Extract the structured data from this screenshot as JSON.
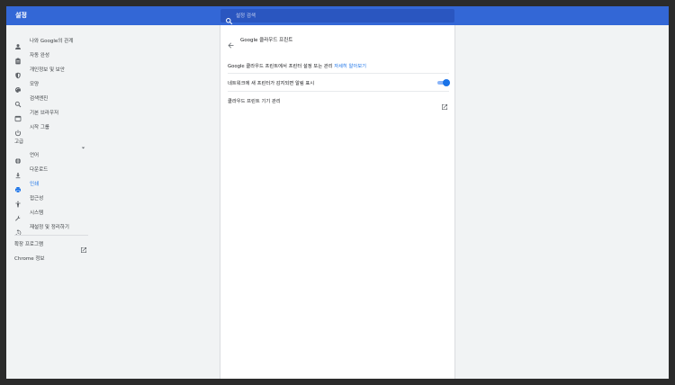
{
  "app": {
    "title": "설정"
  },
  "search": {
    "placeholder": "설정 검색"
  },
  "sidebar": {
    "items": [
      {
        "label": "나와 Google의 관계",
        "icon": "person-icon"
      },
      {
        "label": "자동 완성",
        "icon": "clipboard-icon"
      },
      {
        "label": "개인정보 및 보안",
        "icon": "shield-icon"
      },
      {
        "label": "모양",
        "icon": "palette-icon"
      },
      {
        "label": "검색엔진",
        "icon": "search-icon"
      },
      {
        "label": "기본 브라우저",
        "icon": "browser-icon"
      },
      {
        "label": "시작 그룹",
        "icon": "power-icon"
      }
    ],
    "advanced_label": "고급",
    "advanced_items": [
      {
        "label": "언어",
        "icon": "globe-icon"
      },
      {
        "label": "다운로드",
        "icon": "download-icon"
      },
      {
        "label": "인쇄",
        "icon": "printer-icon",
        "active": true
      },
      {
        "label": "접근성",
        "icon": "accessibility-icon"
      },
      {
        "label": "시스템",
        "icon": "wrench-icon"
      },
      {
        "label": "재설정 및 정리하기",
        "icon": "restore-icon"
      }
    ],
    "extensions_label": "확장 프로그램",
    "about_label": "Chrome 정보"
  },
  "main": {
    "title": "Google 클라우드 프린트",
    "rows": [
      {
        "text": "Google 클라우드 프린트에서 프린터 설정 또는 관리",
        "link": "자세히 알아보기"
      },
      {
        "text": "네트워크에 새 프린터가 감지되면 알림 표시",
        "toggle_on": true
      },
      {
        "text": "클라우드 프린트 기기 관리"
      }
    ]
  },
  "colors": {
    "accent": "#1a73e8",
    "header": "#3367d6",
    "sidebar_bg": "#f1f3f4"
  }
}
